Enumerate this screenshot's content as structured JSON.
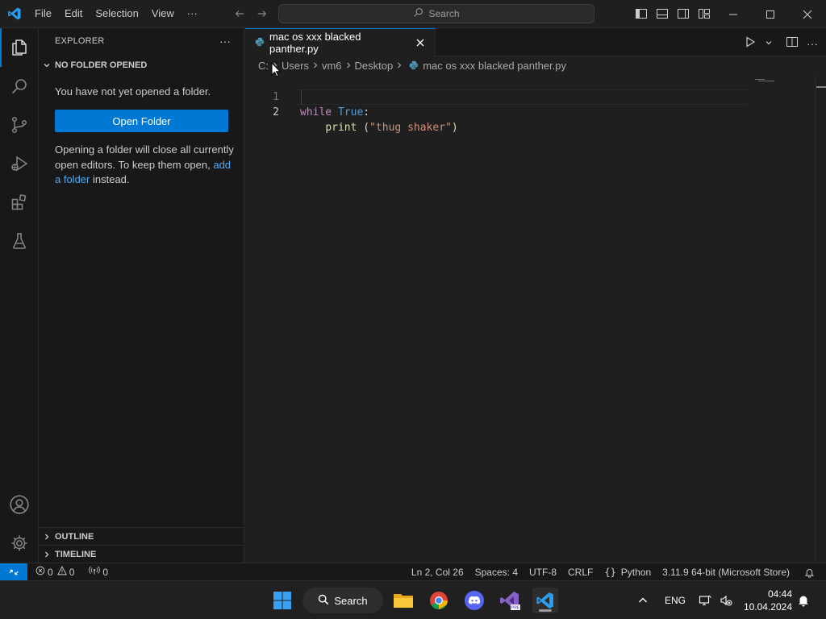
{
  "titlebar": {
    "menu": [
      "File",
      "Edit",
      "Selection",
      "View",
      "···"
    ],
    "search_label": "Search"
  },
  "sidebar": {
    "title": "EXPLORER",
    "more": "···",
    "section_title": "NO FOLDER OPENED",
    "msg1": "You have not yet opened a folder.",
    "open_folder_label": "Open Folder",
    "msg2_prefix": "Opening a folder will close all currently open editors. To keep them open, ",
    "msg2_link": "add a folder",
    "msg2_suffix": " instead.",
    "outline_label": "OUTLINE",
    "timeline_label": "TIMELINE"
  },
  "editor": {
    "tab_label": "mac os xxx blacked panther.py",
    "breadcrumb": [
      "C:",
      "Users",
      "vm6",
      "Desktop",
      "mac os xxx blacked panther.py"
    ],
    "lines": [
      {
        "num": "1",
        "kw": "while",
        "const": "True",
        "rest": ":"
      },
      {
        "num": "2",
        "indent": "    ",
        "fn": "print",
        "open": " (",
        "str": "\"thug shaker\"",
        "close": ")"
      }
    ]
  },
  "statusbar": {
    "errors": "0",
    "warnings": "0",
    "ports": "0",
    "position": "Ln 2, Col 26",
    "spaces": "Spaces: 4",
    "encoding": "UTF-8",
    "eol": "CRLF",
    "language": "Python",
    "interpreter": "3.11.9 64-bit (Microsoft Store)"
  },
  "taskbar": {
    "search_label": "Search",
    "lang": "ENG",
    "time": "04:44",
    "date": "10.04.2024"
  },
  "colors": {
    "accent": "#0078d4",
    "link": "#4daafc",
    "background": "#1f1f1f",
    "sidebar_bg": "#181818"
  }
}
